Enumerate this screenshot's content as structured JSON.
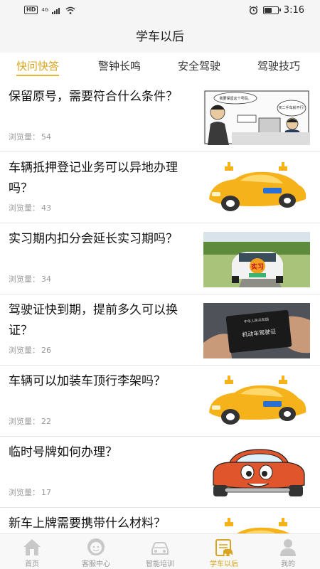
{
  "status": {
    "left_badge": "HD",
    "network": "4G",
    "time": "3:16",
    "battery_level": 0.55
  },
  "title": "学车以后",
  "tabs": [
    {
      "label": "快问快答",
      "active": true
    },
    {
      "label": "警钟长鸣",
      "active": false
    },
    {
      "label": "安全驾驶",
      "active": false
    },
    {
      "label": "驾驶技巧",
      "active": false
    }
  ],
  "articles": [
    {
      "title": "保留原号，需要符合什么条件？",
      "views_label": "浏览量：",
      "views": "54",
      "thumb": "comic-plate-illustration",
      "thumb_text": {
        "bubble1": "我要保留这个号码。",
        "bubble2": "买二手车就不行!"
      }
    },
    {
      "title": "车辆抵押登记业务可以异地办理吗？",
      "views_label": "浏览量：",
      "views": "43",
      "thumb": "yellow-cartoon-car"
    },
    {
      "title": "实习期内扣分会延长实习期吗？",
      "views_label": "浏览量：",
      "views": "34",
      "thumb": "car-with-intern-sign-photo",
      "thumb_text": {
        "sign": "实习"
      }
    },
    {
      "title": "驾驶证快到期，提前多久可以换证？",
      "views_label": "浏览量：",
      "views": "26",
      "thumb": "license-booklet-photo",
      "thumb_text": {
        "top": "中华人民共和国",
        "main": "机动车驾驶证"
      }
    },
    {
      "title": "车辆可以加装车顶行李架吗？",
      "views_label": "浏览量：",
      "views": "22",
      "thumb": "yellow-cartoon-car"
    },
    {
      "title": "临时号牌如何办理？",
      "views_label": "浏览量：",
      "views": "17",
      "thumb": "red-smiling-cartoon-car"
    },
    {
      "title": "新车上牌需要携带什么材料？",
      "views_label": "浏览量：",
      "views": "",
      "thumb": "yellow-cartoon-car"
    }
  ],
  "bottom_nav": [
    {
      "label": "首页",
      "icon": "home-icon",
      "active": false
    },
    {
      "label": "客服中心",
      "icon": "customer-service-icon",
      "active": false
    },
    {
      "label": "智能培训",
      "icon": "car-training-icon",
      "active": false
    },
    {
      "label": "学车以后",
      "icon": "after-driving-icon",
      "active": true
    },
    {
      "label": "我的",
      "icon": "user-icon",
      "active": false
    }
  ],
  "colors": {
    "accent": "#d9a520",
    "car_yellow": "#f6b21b",
    "car_red": "#e0552b"
  }
}
